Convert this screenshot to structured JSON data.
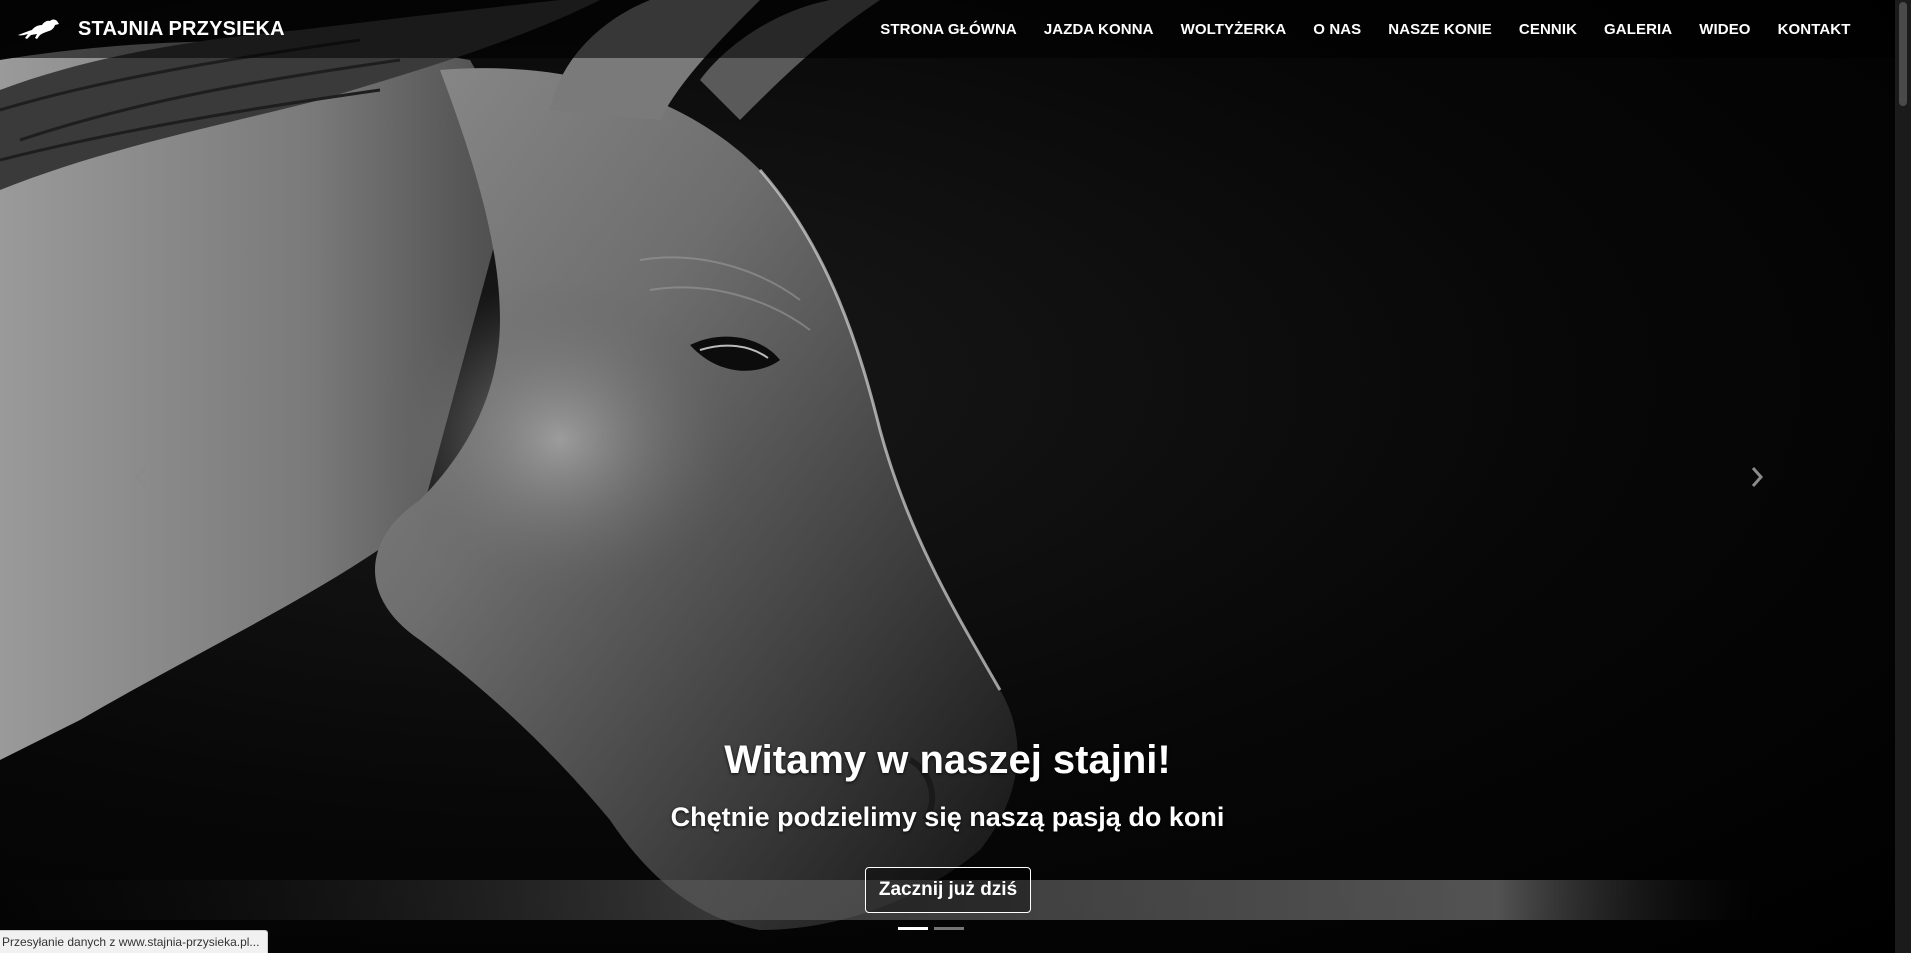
{
  "brand": {
    "name": "STAJNIA PRZYSIEKA",
    "logo_icon": "horse-icon"
  },
  "nav": {
    "items": [
      {
        "label": "STRONA GŁÓWNA"
      },
      {
        "label": "JAZDA KONNA"
      },
      {
        "label": "WOLTYŻERKA"
      },
      {
        "label": "O NAS"
      },
      {
        "label": "NASZE KONIE"
      },
      {
        "label": "CENNIK"
      },
      {
        "label": "GALERIA"
      },
      {
        "label": "WIDEO"
      },
      {
        "label": "KONTAKT"
      }
    ]
  },
  "carousel": {
    "title": "Witamy w naszej stajni!",
    "subtitle": "Chętnie podzielimy się naszą pasją do koni",
    "cta_label": "Zacznij już dziś",
    "prev_icon": "chevron-left-icon",
    "next_icon": "chevron-right-icon",
    "slide_count": 2,
    "active_slide": 1
  },
  "status_bar": {
    "text": "Przesyłanie danych z www.stajnia-przysieka.pl..."
  },
  "colors": {
    "background": "#000000",
    "text": "#ffffff",
    "navbar_bg": "rgba(0,0,0,0.55)"
  }
}
